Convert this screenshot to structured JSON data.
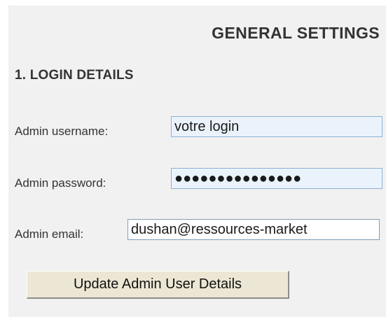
{
  "page": {
    "title": "GENERAL SETTINGS"
  },
  "login_section": {
    "heading": "1. LOGIN DETAILS",
    "username_label": "Admin username:",
    "username_value": "votre login",
    "password_label": "Admin password:",
    "password_mask": "●●●●●●●●●●●●●●●",
    "email_label": "Admin email:",
    "email_value": "dushan@ressources-market",
    "update_button": "Update Admin User Details"
  },
  "colors": {
    "panel_background": "#f1f1f1",
    "field_highlight": "#eaf3fc",
    "button_background": "#ece6d4"
  }
}
